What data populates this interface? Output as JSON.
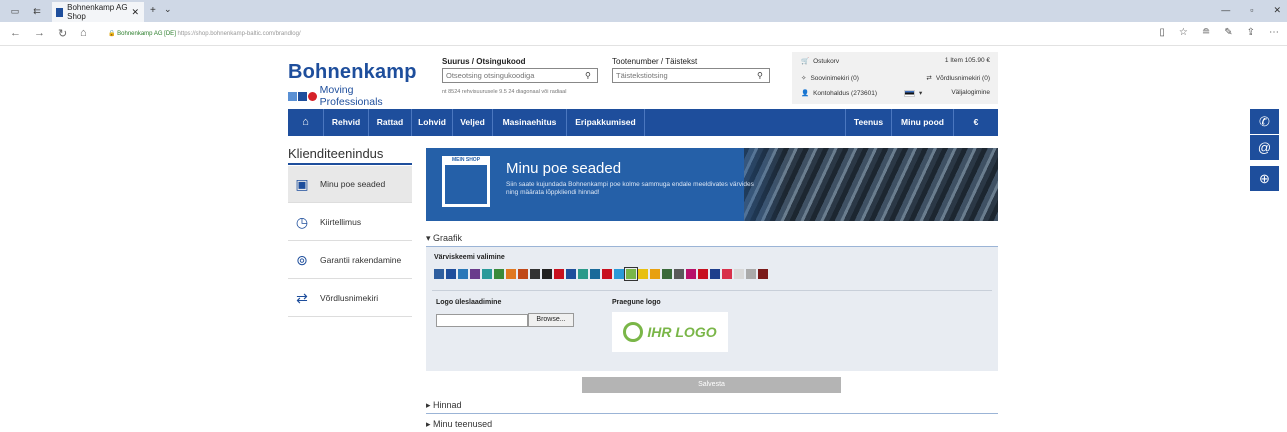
{
  "browser": {
    "tab_title": "Bohnenkamp AG Shop",
    "url_secure": "Bohnenkamp AG [DE]",
    "url_rest": "https://shop.bohnenkamp-baltic.com/brandlog/"
  },
  "header": {
    "logo_text": "Bohnenkamp",
    "logo_tagline": "Moving Professionals",
    "size_search_label": "Suurus / Otsingukood",
    "size_search_placeholder": "Otseotsing otsingukoodiga",
    "size_search_hint": "nt 8524 rehvisuurusele 9.5 24 diagonaal või radiaal",
    "text_search_label": "Tootenumber / Täistekst",
    "text_search_placeholder": "Täistekstiotsing"
  },
  "account": {
    "cart_label": "Ostukorv",
    "cart_summary": "1 Item  105.90 €",
    "wishlist": "Soovinimekiri (0)",
    "compare": "Võrdlusnimekiri (0)",
    "account_name": "Kontohaldus (273601)",
    "logout": "Väljalogimine"
  },
  "nav": {
    "items": [
      "Rehvid",
      "Rattad",
      "Lohvid",
      "Veljed",
      "Masinaehitus",
      "Eripakkumised",
      "Teenus",
      "Minu pood",
      "€"
    ]
  },
  "sidebar": {
    "title": "Klienditeenindus",
    "items": [
      {
        "label": "Minu poe seaded",
        "icon": "shop-icon"
      },
      {
        "label": "Kiirtellimus",
        "icon": "clock-icon"
      },
      {
        "label": "Garantii rakendamine",
        "icon": "warranty-icon"
      },
      {
        "label": "Võrdlusnimekiri",
        "icon": "compare-icon"
      }
    ]
  },
  "banner": {
    "badge": "MEIN SHOP",
    "title": "Minu poe seaded",
    "description": "Siin saate kujundada Bohnenkampi poe kolme sammuga endale meeldivates värvides ning määrata lõppkliendi hinnad!"
  },
  "sections": {
    "graafik": "Graafik",
    "color_scheme_label": "Värviskeemi valimine",
    "logo_upload_label": "Logo üleslaadimine",
    "current_logo_label": "Praegune logo",
    "browse_label": "Browse...",
    "logo_preview_text": "IHR LOGO",
    "save_label": "Salvesta",
    "hinnad": "Hinnad",
    "minu_teenused": "Minu teenused"
  },
  "swatch_colors": [
    "#2e5e9e",
    "#1e4e9c",
    "#2a78b8",
    "#6a3c8c",
    "#2a9a9a",
    "#3a8a3a",
    "#e07820",
    "#c04818",
    "#333333",
    "#222222",
    "#c8101e",
    "#1e4e9c",
    "#2a9a8a",
    "#1a6a9a",
    "#c8101e",
    "#2a9ad8",
    "#7ab648",
    "#e8c010",
    "#e8a010",
    "#3a6a3a",
    "#5a5a5a",
    "#b8106a",
    "#c8101e",
    "#1e3e8c",
    "#d8304a",
    "#d8d8d8",
    "#aaaaaa",
    "#7a1a1a"
  ],
  "selected_swatch": 16
}
